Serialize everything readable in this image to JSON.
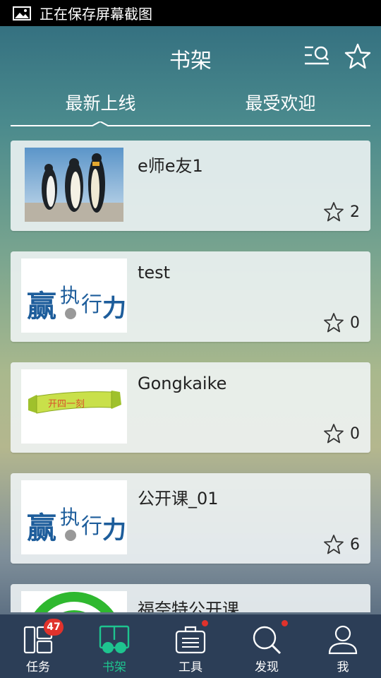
{
  "status_bar": {
    "text": "正在保存屏幕截图",
    "icon": "image-icon"
  },
  "header": {
    "title": "书架",
    "search_icon": "search-list-icon",
    "star_icon": "star-icon"
  },
  "tabs": [
    {
      "label": "最新上线",
      "active": true
    },
    {
      "label": "最受欢迎",
      "active": false
    }
  ],
  "books": [
    {
      "title": "e师e友1",
      "favorites": "2",
      "thumb": "penguins-image"
    },
    {
      "title": "test",
      "favorites": "0",
      "thumb": "yingzhixingli-logo"
    },
    {
      "title": "Gongkaike",
      "favorites": "0",
      "thumb": "banner-logo"
    },
    {
      "title": "公开课_01",
      "favorites": "6",
      "thumb": "yingzhixingli-logo"
    },
    {
      "title": "福奈特公开课",
      "favorites": "",
      "thumb": "green-circle-logo"
    }
  ],
  "bottom_nav": [
    {
      "label": "任务",
      "icon": "task-icon",
      "badge": "47",
      "active": false
    },
    {
      "label": "书架",
      "icon": "bookshelf-icon",
      "active": true
    },
    {
      "label": "工具",
      "icon": "toolbox-icon",
      "dot": true,
      "active": false
    },
    {
      "label": "发现",
      "icon": "discover-search-icon",
      "dot": true,
      "active": false
    },
    {
      "label": "我",
      "icon": "user-icon",
      "active": false
    }
  ],
  "colors": {
    "accent": "#1ec48f",
    "nav_bg": "#2c3e57",
    "badge": "#e0322c"
  }
}
